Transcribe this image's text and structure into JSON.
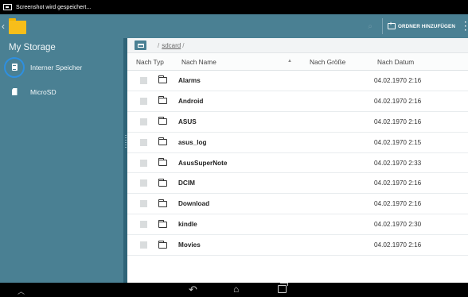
{
  "status_bar": {
    "notification": "Screenshot wird gespeichert..."
  },
  "action_bar": {
    "add_folder_label": "ORDNER HINZUFÜGEN"
  },
  "sidebar": {
    "title": "My Storage",
    "items": [
      {
        "label": "Interner Speicher",
        "icon": "internal-storage-icon",
        "selected": true
      },
      {
        "label": "MicroSD",
        "icon": "sd-card-icon",
        "selected": false
      }
    ]
  },
  "path": {
    "separator": "/",
    "segment": "sdcard",
    "trailing": "/"
  },
  "columns": {
    "type": "Nach Typ",
    "name": "Nach Name",
    "size": "Nach Größe",
    "date": "Nach Datum"
  },
  "files": [
    {
      "name": "Alarms",
      "size": "",
      "date": "04.02.1970 2:16"
    },
    {
      "name": "Android",
      "size": "",
      "date": "04.02.1970 2:16"
    },
    {
      "name": "ASUS",
      "size": "",
      "date": "04.02.1970 2:16"
    },
    {
      "name": "asus_log",
      "size": "",
      "date": "04.02.1970 2:15"
    },
    {
      "name": "AsusSuperNote",
      "size": "",
      "date": "04.02.1970 2:33"
    },
    {
      "name": "DCIM",
      "size": "",
      "date": "04.02.1970 2:16"
    },
    {
      "name": "Download",
      "size": "",
      "date": "04.02.1970 2:16"
    },
    {
      "name": "kindle",
      "size": "",
      "date": "04.02.1970 2:30"
    },
    {
      "name": "Movies",
      "size": "",
      "date": "04.02.1970 2:16"
    }
  ],
  "colors": {
    "accent": "#4a8093",
    "selection_ring": "#2e8fe0",
    "folder_yellow": "#f7be1a"
  }
}
